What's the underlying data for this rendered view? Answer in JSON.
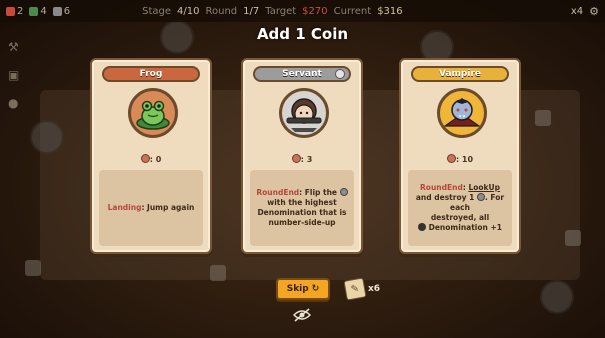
{
  "hud": {
    "res1": "2",
    "res2": "4",
    "res3": "6",
    "stage_label": "Stage",
    "stage_value": "4/10",
    "round_label": "Round",
    "round_value": "1/7",
    "target_label": "Target",
    "target_value": "$270",
    "current_label": "Current",
    "current_value": "$316",
    "speed": "x4"
  },
  "title": "Add 1 Coin",
  "cards": [
    {
      "name": "Frog",
      "count": ": 0",
      "keyword": "Landing",
      "text": ": Jump again",
      "color": "#c9683e"
    },
    {
      "name": "Servant",
      "count": ": 3",
      "keyword": "RoundEnd",
      "text_a": ": Flip the",
      "text_b": "with the highest Denomination that is number-side-up",
      "color": "#9c9c9c"
    },
    {
      "name": "Vampire",
      "count": ": 10",
      "keyword": "RoundEnd",
      "text_a": ":",
      "link": "LookUp",
      "text_b": "and destroy 1",
      "text_c": ". For each",
      "text_d": "destroyed, all",
      "text_e": "Denomination +1",
      "color": "#e8b23a"
    }
  ],
  "skip_label": "Skip",
  "reroll_count": "x6",
  "icons": {
    "skip": "refresh-icon",
    "reroll": "ticket-icon",
    "hide": "eye-slash-icon",
    "settings": "gear-icon"
  }
}
